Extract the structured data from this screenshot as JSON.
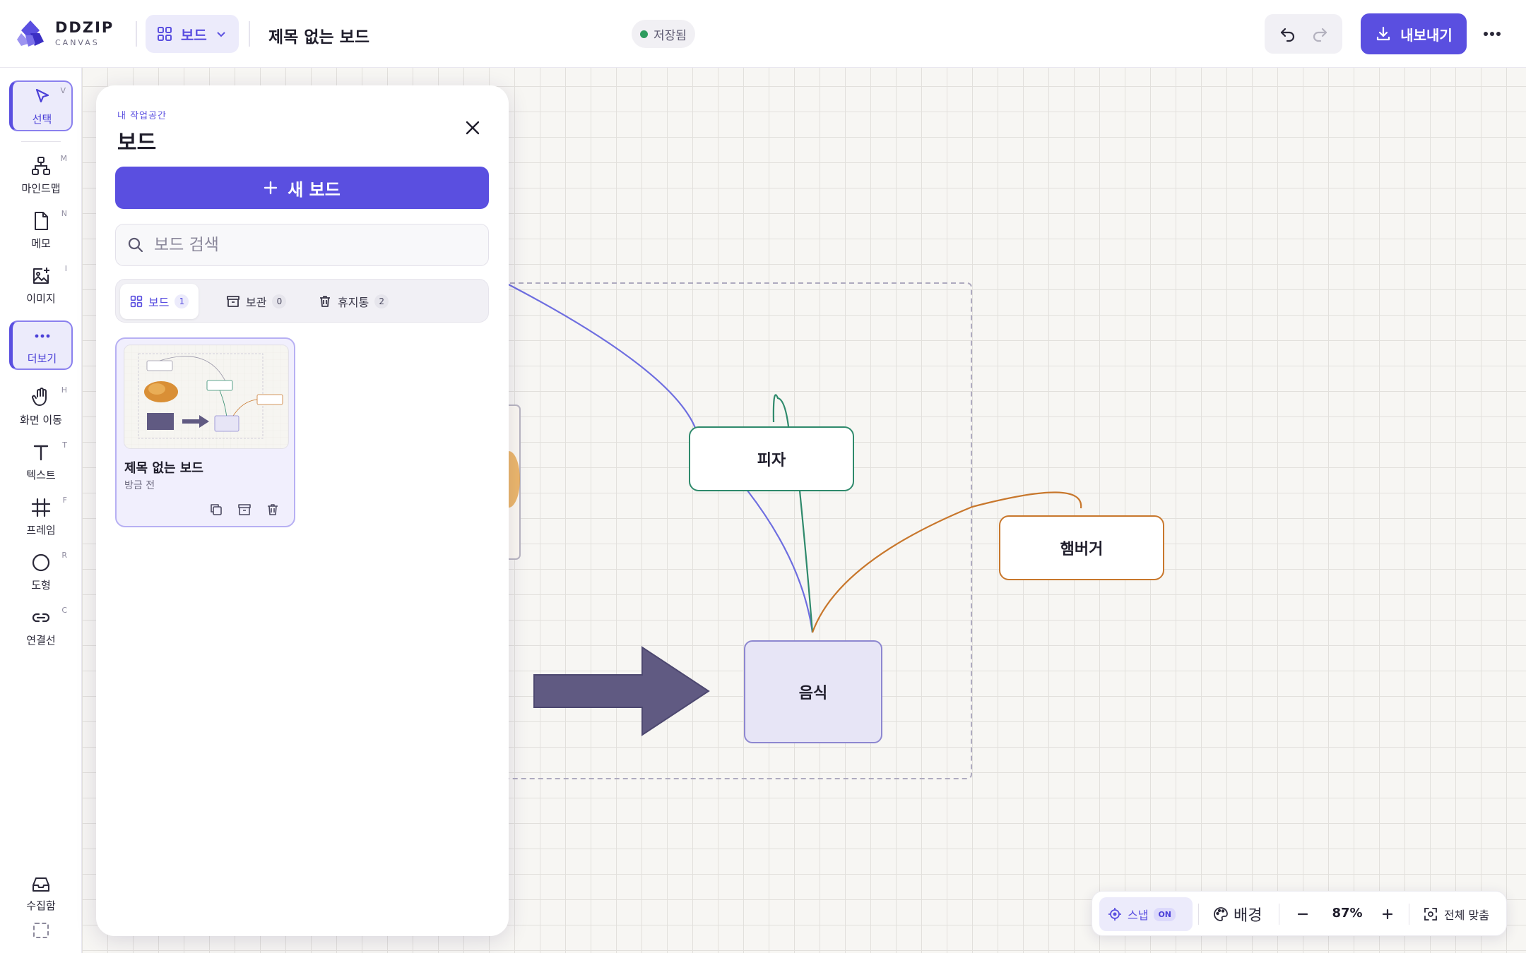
{
  "app": {
    "brand_name": "DDZIP",
    "brand_sub": "CANVAS"
  },
  "header": {
    "board_menu_label": "보드",
    "board_title": "제목 없는 보드",
    "save_status": "저장됨",
    "export_label": "내보내기"
  },
  "tools": [
    {
      "label": "선택",
      "key": "V",
      "icon": "pointer-icon"
    },
    {
      "label": "마인드맵",
      "key": "M",
      "icon": "mindmap-icon"
    },
    {
      "label": "메모",
      "key": "N",
      "icon": "note-icon"
    },
    {
      "label": "이미지",
      "key": "I",
      "icon": "image-add-icon"
    },
    {
      "label": "더보기",
      "key": "",
      "icon": "more-horizontal-icon"
    },
    {
      "label": "화면 이동",
      "key": "H",
      "icon": "hand-icon"
    },
    {
      "label": "텍스트",
      "key": "T",
      "icon": "text-icon"
    },
    {
      "label": "프레임",
      "key": "F",
      "icon": "frame-icon"
    },
    {
      "label": "도형",
      "key": "R",
      "icon": "circle-icon"
    },
    {
      "label": "연결선",
      "key": "C",
      "icon": "link-icon"
    }
  ],
  "inbox": {
    "label": "수집함"
  },
  "panel": {
    "eyebrow": "내 작업공간",
    "title": "보드",
    "new_board_label": "새 보드",
    "search_placeholder": "보드 검색",
    "tabs": [
      {
        "label": "보드",
        "count": "1"
      },
      {
        "label": "보관",
        "count": "0"
      },
      {
        "label": "휴지통",
        "count": "2"
      }
    ],
    "cards": [
      {
        "title": "제목 없는 보드",
        "subtitle": "방금 전"
      }
    ]
  },
  "canvas": {
    "nodes": {
      "pizza": "피자",
      "hamburger": "햄버거",
      "food": "음식"
    },
    "colors": {
      "pizza": "#2f8a6c",
      "hamburger": "#c8772c",
      "food": "#8d87d0",
      "arrow": "#605a82",
      "link_blue": "#6e6ee0"
    }
  },
  "controls": {
    "snap_label": "스냅",
    "snap_state": "ON",
    "background_label": "배경",
    "zoom": "87%",
    "fit_label": "전체 맞춤"
  }
}
